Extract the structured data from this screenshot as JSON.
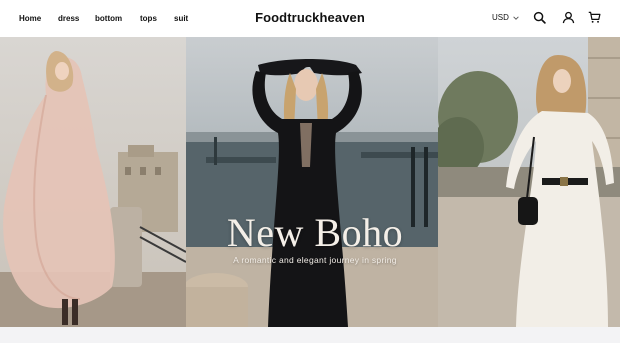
{
  "nav": {
    "items": [
      {
        "label": "Home"
      },
      {
        "label": "dress"
      },
      {
        "label": "bottom"
      },
      {
        "label": "tops"
      },
      {
        "label": "suit"
      }
    ]
  },
  "brand": {
    "name": "Foodtruckheaven"
  },
  "header": {
    "currency": "USD",
    "icons": [
      "search-icon",
      "account-icon",
      "cart-icon"
    ]
  },
  "hero": {
    "title": "New Boho",
    "subtitle": "A romantic and elegant journey in spring"
  },
  "colors": {
    "text": "#111111",
    "hero_text": "#f4efe8",
    "band": "#f3f3f5"
  }
}
